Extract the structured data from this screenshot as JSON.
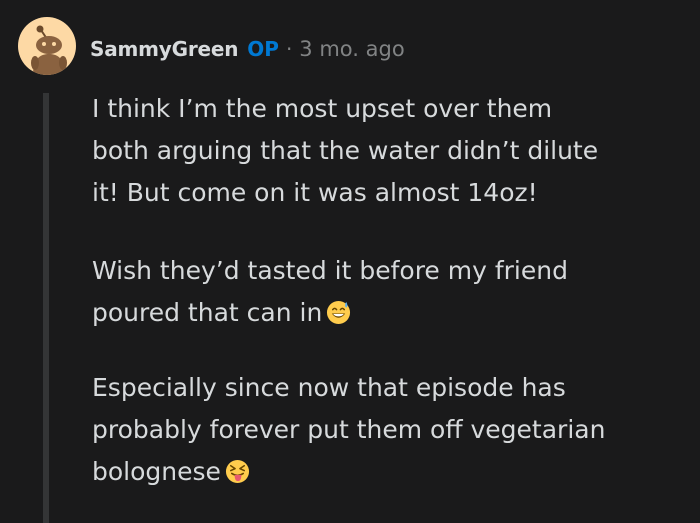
{
  "comment": {
    "author": "SammyGreen",
    "op_badge": "OP",
    "separator": "·",
    "timestamp": "3 mo. ago",
    "avatar_icon": "snoo-avatar-icon",
    "paragraphs": {
      "p1_line1": "I think I’m the most upset over them",
      "p1_line2": "both arguing that the water didn’t dilute",
      "p1_line3": "it! But come on it was almost 14oz!",
      "p2_line1": "Wish they’d tasted it before my friend",
      "p2_line2": "poured that can in",
      "p3_line1": "Especially since now that episode has",
      "p3_line2": "probably forever put them off vegetarian",
      "p3_line3": "bolognese"
    },
    "emojis": {
      "p2": "grinning-sweat-emoji-icon",
      "p3": "squinting-tongue-emoji-icon"
    }
  },
  "colors": {
    "background": "#1a1a1b",
    "text": "#d7dadc",
    "muted": "#818384",
    "op_blue": "#0079d3",
    "thread_line": "#343536",
    "avatar_bg": "#fdd9a5"
  }
}
